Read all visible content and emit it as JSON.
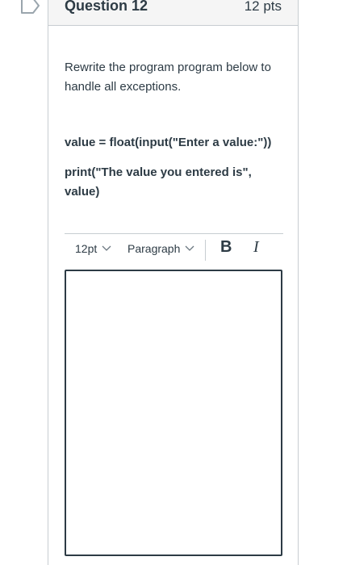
{
  "question": {
    "title": "Question 12",
    "points": "12 pts",
    "prompt": "Rewrite the program program below to handle all exceptions.",
    "code_line_1": "value = float(input(\"Enter a value:\"))",
    "code_line_2": "print(\"The value you entered is\", value)"
  },
  "editor": {
    "font_size": "12pt",
    "block_format": "Paragraph",
    "bold_label": "B",
    "italic_label": "I",
    "body": ""
  },
  "icons": {
    "flag": "flag-outline-icon",
    "dropdown": "chevron-down-icon"
  },
  "colors": {
    "text": "#2d3b45",
    "border": "#c7cdd1",
    "header_bg": "#f5f5f5"
  }
}
